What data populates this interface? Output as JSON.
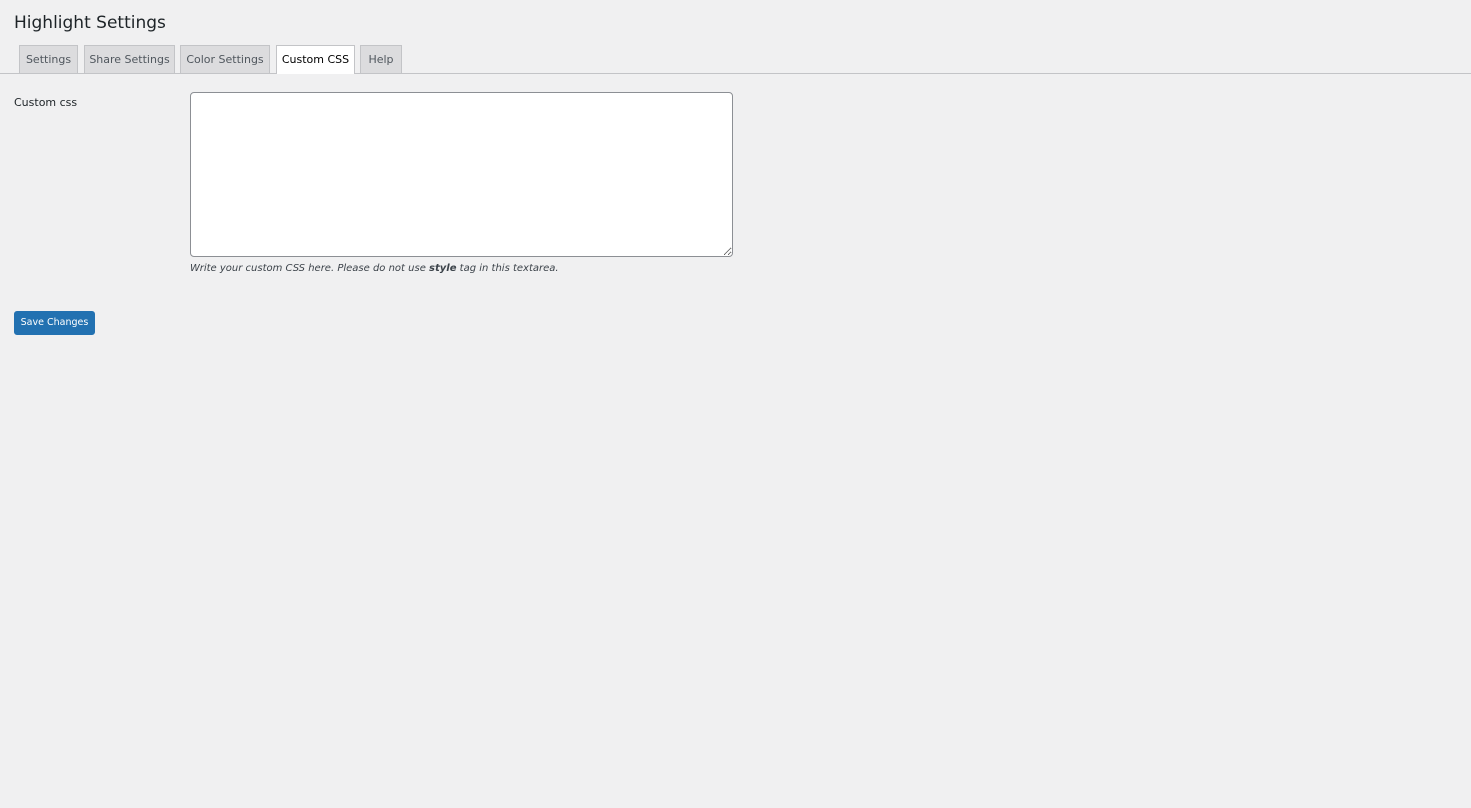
{
  "page": {
    "title": "Highlight Settings"
  },
  "tabs": [
    {
      "label": "Settings",
      "active": false
    },
    {
      "label": "Share Settings",
      "active": false
    },
    {
      "label": "Color Settings",
      "active": false
    },
    {
      "label": "Custom CSS",
      "active": true
    },
    {
      "label": "Help",
      "active": false
    }
  ],
  "custom_css": {
    "label": "Custom css",
    "value": "",
    "description_before": "Write your custom CSS here. Please do not use ",
    "description_bold": "style",
    "description_after": " tag in this textarea."
  },
  "actions": {
    "save_label": "Save Changes"
  },
  "colors": {
    "background": "#f0f0f1",
    "primary_button": "#2271b1",
    "tab_inactive": "#dcdcde",
    "tab_active": "#ffffff"
  }
}
